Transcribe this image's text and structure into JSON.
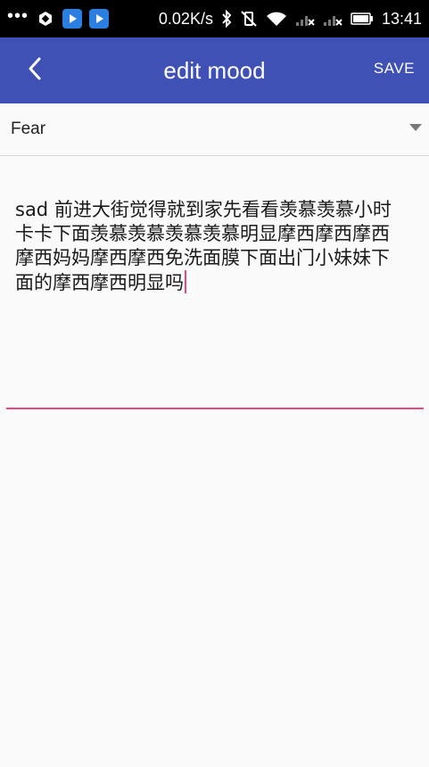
{
  "status_bar": {
    "dots": "•••",
    "network_speed": "0.02K/s",
    "time": "13:41",
    "icons": [
      "game-controller-icon",
      "play-app-icon",
      "play-app-icon",
      "bluetooth-icon",
      "vibrate-off-icon",
      "wifi-icon",
      "signal-icon",
      "signal-icon",
      "battery-icon"
    ]
  },
  "app_bar": {
    "back_icon": "chevron-left-icon",
    "title": "edit mood",
    "save_label": "SAVE",
    "color": "#3f51b5"
  },
  "mood_spinner": {
    "selected": "Fear",
    "caret_icon": "dropdown-triangle-icon"
  },
  "note": {
    "text": "sad 前进大街觉得就到家先看看羡慕羡慕小时卡卡下面羡慕羡慕羡慕羡慕明显摩西摩西摩西摩西妈妈摩西摩西免洗面膜下面出门小妹妹下面的摩西摩西明显吗",
    "accent_color": "#e9477a"
  }
}
